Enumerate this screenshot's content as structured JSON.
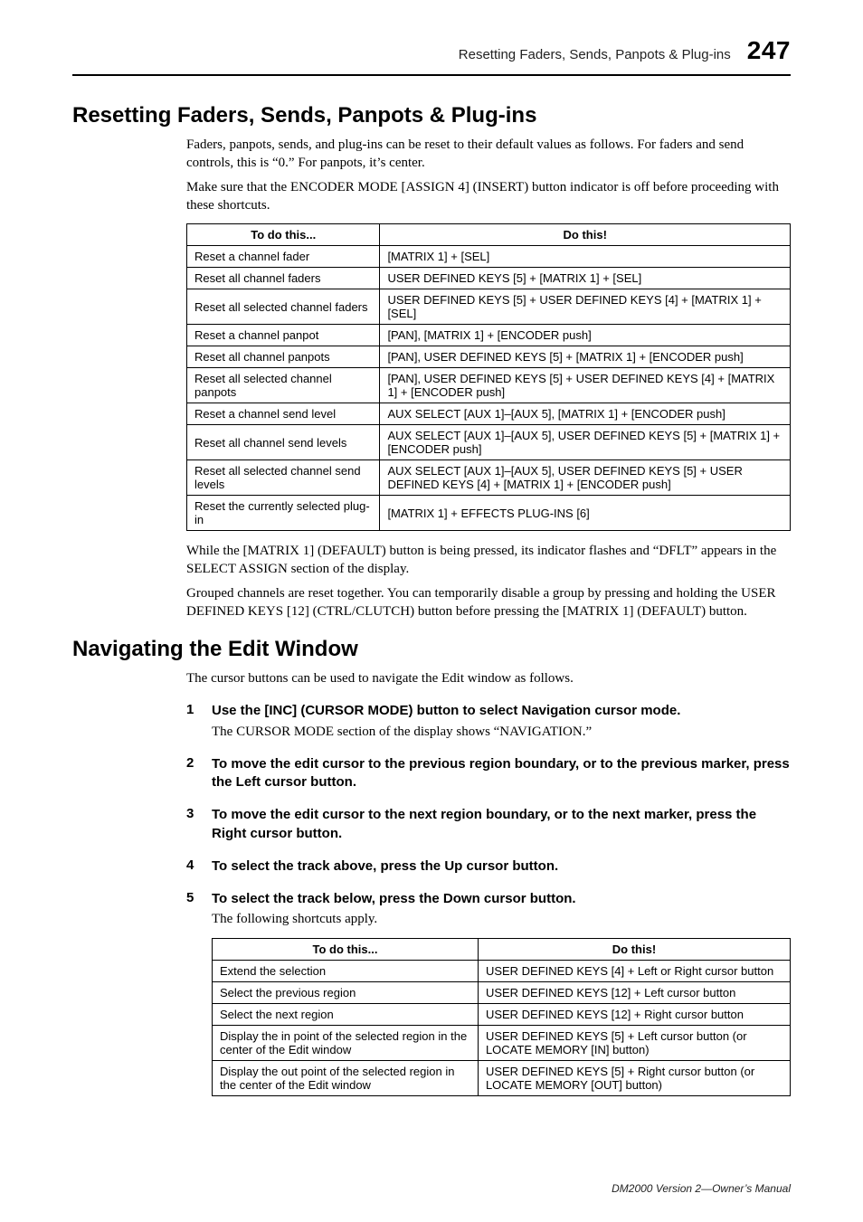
{
  "header": {
    "running_title": "Resetting Faders, Sends, Panpots & Plug-ins",
    "page_number": "247"
  },
  "section1": {
    "heading": "Resetting Faders, Sends, Panpots & Plug-ins",
    "p1": "Faders, panpots, sends, and plug-ins can be reset to their default values as follows. For faders and send controls, this is “0.” For panpots, it’s center.",
    "p2": "Make sure that the ENCODER MODE [ASSIGN 4] (INSERT) button indicator is off before proceeding with these shortcuts.",
    "table": {
      "h1": "To do this...",
      "h2": "Do this!",
      "rows": [
        {
          "c1": "Reset a channel fader",
          "c2": "[MATRIX 1] + [SEL]"
        },
        {
          "c1": "Reset all channel faders",
          "c2": "USER DEFINED KEYS [5] + [MATRIX 1] + [SEL]"
        },
        {
          "c1": "Reset all selected channel faders",
          "c2": "USER DEFINED KEYS [5] + USER DEFINED KEYS [4] + [MATRIX 1] + [SEL]"
        },
        {
          "c1": "Reset a channel panpot",
          "c2": "[PAN], [MATRIX 1] + [ENCODER push]"
        },
        {
          "c1": "Reset all channel panpots",
          "c2": "[PAN], USER DEFINED KEYS [5] + [MATRIX 1] + [ENCODER push]"
        },
        {
          "c1": "Reset all selected channel panpots",
          "c2": "[PAN], USER DEFINED KEYS [5] + USER DEFINED KEYS [4] + [MATRIX 1] + [ENCODER push]"
        },
        {
          "c1": "Reset a channel send level",
          "c2": "AUX SELECT [AUX 1]–[AUX 5], [MATRIX 1] + [ENCODER push]"
        },
        {
          "c1": "Reset all channel send levels",
          "c2": "AUX SELECT [AUX 1]–[AUX 5], USER DEFINED KEYS [5] + [MATRIX 1] + [ENCODER push]"
        },
        {
          "c1": "Reset all selected channel send levels",
          "c2": "AUX SELECT [AUX 1]–[AUX 5], USER DEFINED KEYS [5] + USER DEFINED KEYS [4] + [MATRIX 1] + [ENCODER push]"
        },
        {
          "c1": "Reset the currently selected plug-in",
          "c2": "[MATRIX 1] + EFFECTS PLUG-INS [6]"
        }
      ]
    },
    "p3": "While the [MATRIX 1] (DEFAULT) button is being pressed, its indicator flashes and “DFLT” appears in the SELECT ASSIGN section of the display.",
    "p4": "Grouped channels are reset together. You can temporarily disable a group by pressing and holding the USER DEFINED KEYS [12] (CTRL/CLUTCH) button before pressing the [MATRIX 1] (DEFAULT) button."
  },
  "section2": {
    "heading": "Navigating the Edit Window",
    "intro": "The cursor buttons can be used to navigate the Edit window as follows.",
    "steps": [
      {
        "title": "Use the [INC] (CURSOR MODE) button to select Navigation cursor mode.",
        "body": "The CURSOR MODE section of the display shows “NAVIGATION.”"
      },
      {
        "title": "To move the edit cursor to the previous region boundary, or to the previous marker, press the Left cursor button.",
        "body": ""
      },
      {
        "title": "To move the edit cursor to the next region boundary, or to the next marker, press the Right cursor button.",
        "body": ""
      },
      {
        "title": "To select the track above, press the Up cursor button.",
        "body": ""
      },
      {
        "title": "To select the track below, press the Down cursor button.",
        "body": "The following shortcuts apply."
      }
    ],
    "table": {
      "h1": "To do this...",
      "h2": "Do this!",
      "rows": [
        {
          "c1": "Extend the selection",
          "c2": "USER DEFINED KEYS [4] + Left or Right cursor button"
        },
        {
          "c1": "Select the previous region",
          "c2": "USER DEFINED KEYS [12] + Left cursor button"
        },
        {
          "c1": "Select the next region",
          "c2": "USER DEFINED KEYS [12] + Right cursor button"
        },
        {
          "c1": "Display the in point of the selected region in the center of the Edit window",
          "c2": "USER DEFINED KEYS [5] + Left cursor button (or LOCATE MEMORY [IN] button)"
        },
        {
          "c1": "Display the out point of the selected region in the center of the Edit window",
          "c2": "USER DEFINED KEYS [5] + Right cursor button (or LOCATE MEMORY [OUT] button)"
        }
      ]
    }
  },
  "footer": "DM2000 Version 2—Owner’s Manual"
}
